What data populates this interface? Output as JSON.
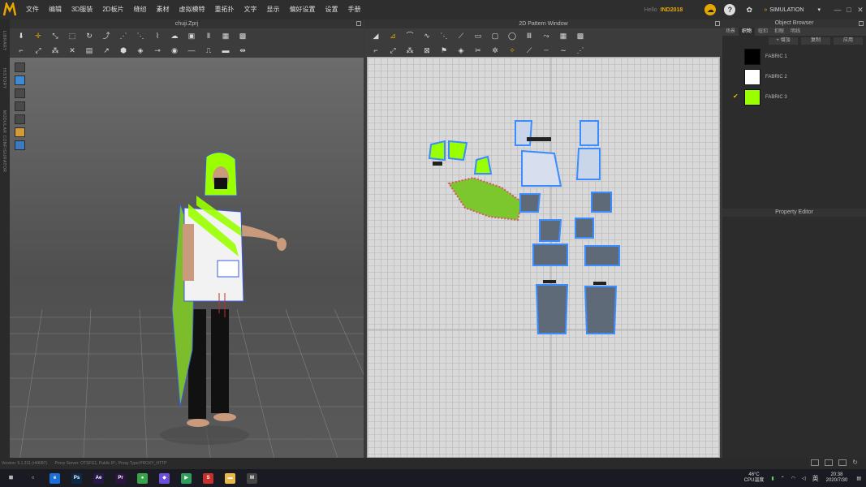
{
  "menu": {
    "items": [
      "文件",
      "编辑",
      "3D服装",
      "2D板片",
      "缝纫",
      "素材",
      "虚拟模特",
      "重拓扑",
      "文字",
      "显示",
      "偏好设置",
      "设置",
      "手册"
    ],
    "hello": "Hello",
    "user": "IND2018",
    "simulation": "SIMULATION",
    "window_controls": [
      "—",
      "□",
      "✕"
    ]
  },
  "left_strip": {
    "labels": [
      "LIBRARY",
      "HISTORY",
      "MODULAR CONFIGURATOR"
    ]
  },
  "window3d": {
    "title": "chuji.Zprj"
  },
  "window2d": {
    "title": "2D Pattern Window"
  },
  "object_browser": {
    "title": "Object Browser",
    "tabs": [
      "场景",
      "织物",
      "纽扣",
      "扣眼",
      "明线"
    ],
    "active_tab": 1,
    "buttons": [
      "+ 增加",
      "复制",
      "应用"
    ],
    "fabrics": [
      {
        "name": "FABRIC 1",
        "color": "#000000",
        "selected": false
      },
      {
        "name": "FABRIC 2",
        "color": "#ffffff",
        "selected": false
      },
      {
        "name": "FABRIC 3",
        "color": "#9aff00",
        "selected": true
      }
    ]
  },
  "property_editor": {
    "title": "Property Editor"
  },
  "status": {
    "version": "Version: 5.1.311 (r44087)",
    "proxy": "Proxy Server: OTSFG1, Public IP:, Proxy Type:PROXY_HTTP"
  },
  "taskbar": {
    "apps": [
      {
        "name": "start-button",
        "label": "⊞",
        "color": "transparent"
      },
      {
        "name": "search-button",
        "label": "○",
        "color": "transparent"
      },
      {
        "name": "edge-app",
        "label": "e",
        "color": "#1c6fd6"
      },
      {
        "name": "photoshop-app",
        "label": "Ps",
        "color": "#0b2a4a"
      },
      {
        "name": "after-effects-app",
        "label": "Ae",
        "color": "#27184a"
      },
      {
        "name": "premiere-app",
        "label": "Pr",
        "color": "#2b1441"
      },
      {
        "name": "green-app",
        "label": "●",
        "color": "#3aa34a"
      },
      {
        "name": "purple-app",
        "label": "◆",
        "color": "#6b4fd8"
      },
      {
        "name": "play-app",
        "label": "▶",
        "color": "#2e9e5a"
      },
      {
        "name": "red-app",
        "label": "S",
        "color": "#c9302c"
      },
      {
        "name": "folder-app",
        "label": "▬",
        "color": "#e8b84a"
      },
      {
        "name": "marvelous-app",
        "label": "M",
        "color": "#444444"
      }
    ],
    "temp": "46°C",
    "temp_label": "CPU温度",
    "ime": "英",
    "time": "20:38",
    "date": "2020/7/30"
  },
  "colors": {
    "accent": "#e6a800",
    "fabric_green": "#9aff00",
    "pattern_blue": "#3a8cff"
  }
}
